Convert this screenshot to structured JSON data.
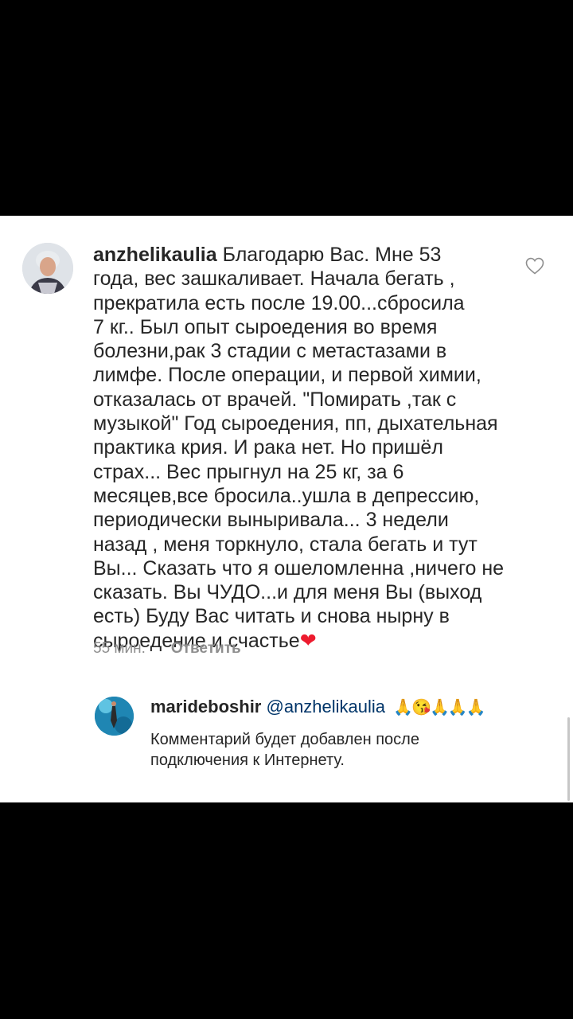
{
  "comment": {
    "username": "anzhelikaulia",
    "text": " Благодарю Вас. Мне 53\nгода, вес зашкаливает. Начала бегать ,\nпрекратила есть после 19.00...сбросила\n7 кг.. Был опыт сыроедения во время\nболезни,рак 3 стадии с метастазами в\nлимфе. После операции, и первой химии,\nотказалась от врачей. \"Помирать ,так с\nмузыкой\" Год сыроедения, пп, дыхательная\nпрактика крия. И рака нет. Но пришёл\nстрах... Вес прыгнул на 25 кг, за 6\nмесяцев,все бросила..ушла в депрессию,\nпериодически выныривала... 3 недели\nназад , меня торкнуло, стала бегать и тут\nВы... Сказать что я ошеломленна ,ничего не\nсказать. Вы ЧУДО...и для меня Вы (выход\nесть) Буду Вас читать и снова нырну в\nсыроедение и счастье",
    "heart_emoji": "❤",
    "time": "55 мин.",
    "reply_label": "Ответить"
  },
  "reply": {
    "username": "marideboshir",
    "mention": "@anzhelikaulia",
    "emojis": "🙏😘🙏🙏🙏",
    "pending_note": "Комментарий будет добавлен после\nподключения к Интернету."
  },
  "icons": {
    "like": "heart-outline-icon"
  },
  "colors": {
    "background": "#ffffff",
    "text": "#262626",
    "secondary": "#8e8e8e",
    "mention": "#003569",
    "heart": "#ed1b2e"
  }
}
